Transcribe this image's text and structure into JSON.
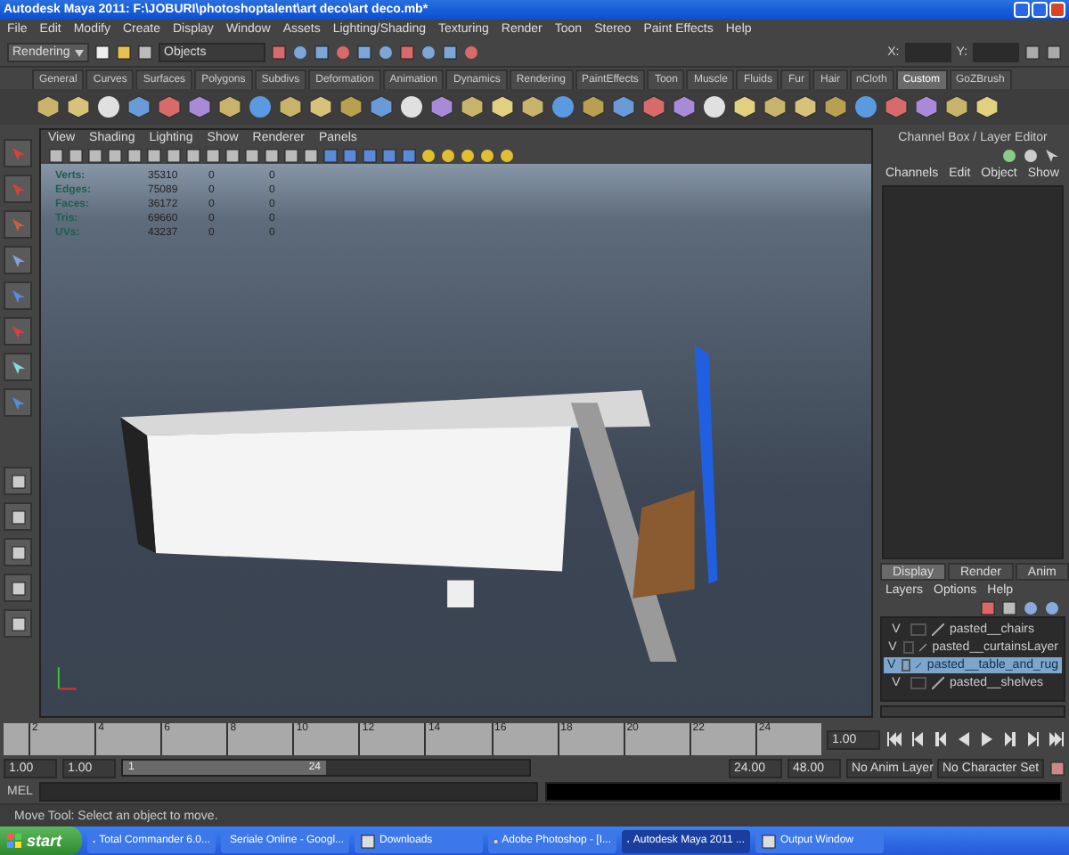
{
  "window": {
    "title": "Autodesk Maya 2011: F:\\JOBURI\\photoshoptalent\\art deco\\art deco.mb*"
  },
  "menu": [
    "File",
    "Edit",
    "Modify",
    "Create",
    "Display",
    "Window",
    "Assets",
    "Lighting/Shading",
    "Texturing",
    "Render",
    "Toon",
    "Stereo",
    "Paint Effects",
    "Help"
  ],
  "status_line": {
    "mode": "Rendering",
    "selection_field": "Objects",
    "x_label": "X:",
    "y_label": "Y:"
  },
  "shelf_tabs": [
    {
      "label": "General",
      "selected": false
    },
    {
      "label": "Curves",
      "selected": false
    },
    {
      "label": "Surfaces",
      "selected": false
    },
    {
      "label": "Polygons",
      "selected": false
    },
    {
      "label": "Subdivs",
      "selected": false
    },
    {
      "label": "Deformation",
      "selected": false
    },
    {
      "label": "Animation",
      "selected": false
    },
    {
      "label": "Dynamics",
      "selected": false
    },
    {
      "label": "Rendering",
      "selected": false
    },
    {
      "label": "PaintEffects",
      "selected": false
    },
    {
      "label": "Toon",
      "selected": false
    },
    {
      "label": "Muscle",
      "selected": false
    },
    {
      "label": "Fluids",
      "selected": false
    },
    {
      "label": "Fur",
      "selected": false
    },
    {
      "label": "Hair",
      "selected": false
    },
    {
      "label": "nCloth",
      "selected": false
    },
    {
      "label": "Custom",
      "selected": true
    },
    {
      "label": "GoZBrush",
      "selected": false
    }
  ],
  "viewport": {
    "menu": [
      "View",
      "Shading",
      "Lighting",
      "Show",
      "Renderer",
      "Panels"
    ],
    "hud": [
      {
        "label": "Verts:",
        "values": [
          "35310",
          "0",
          "0"
        ]
      },
      {
        "label": "Edges:",
        "values": [
          "75089",
          "0",
          "0"
        ]
      },
      {
        "label": "Faces:",
        "values": [
          "36172",
          "0",
          "0"
        ]
      },
      {
        "label": "Tris:",
        "values": [
          "69660",
          "0",
          "0"
        ]
      },
      {
        "label": "UVs:",
        "values": [
          "43237",
          "0",
          "0"
        ]
      }
    ]
  },
  "channel_box": {
    "title": "Channel Box / Layer Editor",
    "menu": [
      "Channels",
      "Edit",
      "Object",
      "Show"
    ]
  },
  "layer_editor": {
    "tabs": [
      {
        "label": "Display",
        "selected": true
      },
      {
        "label": "Render",
        "selected": false
      },
      {
        "label": "Anim",
        "selected": false
      }
    ],
    "menu": [
      "Layers",
      "Options",
      "Help"
    ],
    "layers": [
      {
        "visibility": "V",
        "name": "pasted__chairs",
        "selected": false
      },
      {
        "visibility": "V",
        "name": "pasted__curtainsLayer",
        "selected": false
      },
      {
        "visibility": "V",
        "name": "pasted__table_and_rug",
        "selected": true
      },
      {
        "visibility": "V",
        "name": "pasted__shelves",
        "selected": false
      }
    ]
  },
  "time_slider": {
    "ticks": [
      "2",
      "4",
      "6",
      "8",
      "10",
      "12",
      "14",
      "16",
      "18",
      "20",
      "22",
      "24"
    ],
    "current_frame": "1.00"
  },
  "range_slider": {
    "start": "1.00",
    "playback_start": "1.00",
    "range_start": "1",
    "range_end": "24",
    "level": 0.5,
    "playback_end": "24.00",
    "end": "48.00",
    "anim_layer": "No Anim Layer",
    "character_set": "No Character Set"
  },
  "command_line": {
    "label": "MEL"
  },
  "help_line": "Move Tool: Select an object to move.",
  "taskbar": {
    "start": "start",
    "items": [
      {
        "label": "Total Commander 6.0...",
        "selected": false
      },
      {
        "label": "Seriale Online - Googl...",
        "selected": false
      },
      {
        "label": "Downloads",
        "selected": false
      },
      {
        "label": "Adobe Photoshop - [I...",
        "selected": false
      },
      {
        "label": "Autodesk Maya 2011 ...",
        "selected": true
      },
      {
        "label": "Output Window",
        "selected": false
      }
    ]
  }
}
